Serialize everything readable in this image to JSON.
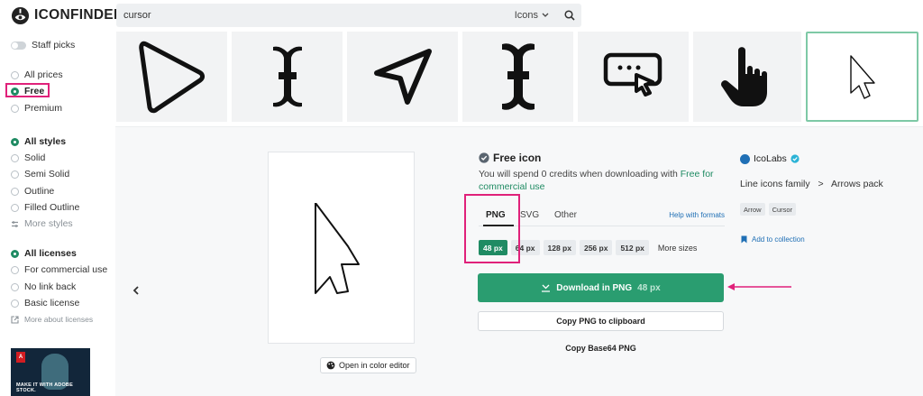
{
  "header": {
    "logo_text": "ICONFINDER",
    "search_value": "cursor",
    "search_scope": "Icons"
  },
  "sidebar": {
    "staff_picks": "Staff picks",
    "prices": [
      "All prices",
      "Free",
      "Premium"
    ],
    "styles": [
      "All styles",
      "Solid",
      "Semi Solid",
      "Outline",
      "Filled Outline"
    ],
    "more_styles": "More styles",
    "licenses": [
      "All licenses",
      "For commercial use",
      "No link back",
      "Basic license"
    ],
    "more_licenses": "More about licenses",
    "ad_text": "MAKE IT WITH ADOBE STOCK."
  },
  "strip": {
    "icons": [
      "cursor-triangle-icon",
      "text-cursor-icon",
      "navigation-cursor-icon",
      "text-cursor-bold-icon",
      "click-cursor-box-icon",
      "hand-pointer-icon",
      "arrow-cursor-icon"
    ],
    "selected_index": 6
  },
  "detail": {
    "title": "Free icon",
    "credits_text": "You will spend 0 credits when downloading with",
    "credits_link": "Free for commercial use",
    "tabs": [
      "PNG",
      "SVG",
      "Other"
    ],
    "help_formats": "Help with formats",
    "sizes": [
      "48 px",
      "64 px",
      "128 px",
      "256 px",
      "512 px"
    ],
    "more_sizes": "More sizes",
    "download_label": "Download in PNG",
    "download_size": "48 px",
    "copy_clipboard": "Copy PNG to clipboard",
    "copy_base64": "Copy Base64 PNG",
    "color_editor": "Open in color editor",
    "author": "IcoLabs",
    "family": "Line icons family",
    "family_sep": ">",
    "pack": "Arrows pack",
    "tags": [
      "Arrow",
      "Cursor"
    ],
    "add_collection": "Add to collection"
  },
  "colors": {
    "accent": "#1f8b63",
    "highlight": "#e0217a"
  }
}
